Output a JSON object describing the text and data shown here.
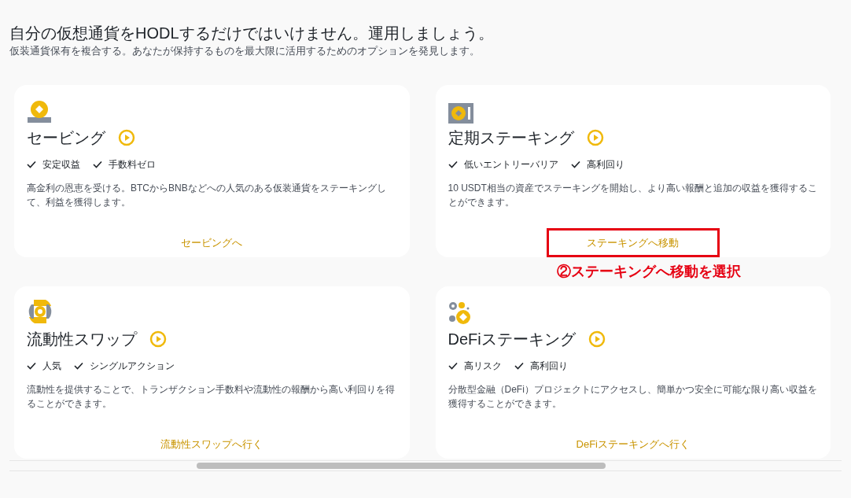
{
  "header": {
    "title": "自分の仮想通貨をHODLするだけではいけません。運用しましょう。",
    "subtitle": "仮装通貨保有を複合する。あなたが保持するものを最大限に活用するためのオプションを発見します。"
  },
  "cards": [
    {
      "kind": "savings",
      "title": "セービング",
      "features": [
        "安定収益",
        "手数料ゼロ"
      ],
      "description": "高金利の恩恵を受ける。BTCからBNBなどへの人気のある仮装通貨をステーキングして、利益を獲得します。",
      "link": "セービングへ",
      "highlighted": false
    },
    {
      "kind": "locked",
      "title": "定期ステーキング",
      "features": [
        "低いエントリーバリア",
        "高利回り"
      ],
      "description": "10 USDT相当の資産でステーキングを開始し、より高い報酬と追加の収益を獲得することができます。",
      "link": "ステーキングへ移動",
      "highlighted": true,
      "annotation": "②ステーキングへ移動を選択"
    },
    {
      "kind": "swap",
      "title": "流動性スワップ",
      "features": [
        "人気",
        "シングルアクション"
      ],
      "description": "流動性を提供することで、トランザクション手数料や流動性の報酬から高い利回りを得ることができます。",
      "link": "流動性スワップへ行く",
      "highlighted": false
    },
    {
      "kind": "defi",
      "title": "DeFiステーキング",
      "features": [
        "高リスク",
        "高利回り"
      ],
      "description": "分散型金融（DeFi）プロジェクトにアクセスし、簡単かつ安全に可能な限り高い収益を獲得することができます。",
      "link": "DeFiステーキングへ行く",
      "highlighted": false
    }
  ]
}
